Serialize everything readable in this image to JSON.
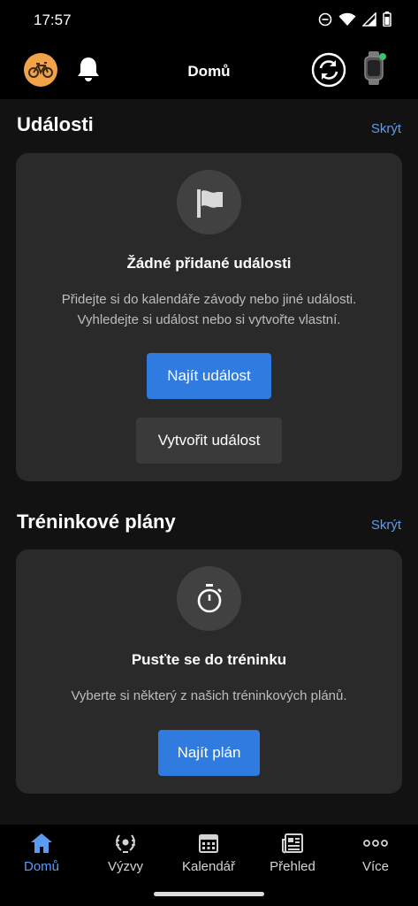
{
  "status": {
    "time": "17:57"
  },
  "header": {
    "title": "Domů"
  },
  "events": {
    "title": "Události",
    "hide": "Skrýt",
    "heading": "Žádné přidané události",
    "text_line1": "Přidejte si do kalendáře závody nebo jiné události.",
    "text_line2": "Vyhledejte si událost nebo si vytvořte vlastní.",
    "find_button": "Najít událost",
    "create_button": "Vytvořit událost"
  },
  "plans": {
    "title": "Tréninkové plány",
    "hide": "Skrýt",
    "heading": "Pusťte se do tréninku",
    "text": "Vyberte si některý z našich tréninkových plánů.",
    "find_button": "Najít plán"
  },
  "nav": {
    "items": [
      {
        "label": "Domů",
        "icon": "home-icon",
        "active": true
      },
      {
        "label": "Výzvy",
        "icon": "laurel-icon"
      },
      {
        "label": "Kalendář",
        "icon": "calendar-icon"
      },
      {
        "label": "Přehled",
        "icon": "news-icon"
      },
      {
        "label": "Více",
        "icon": "more-icon"
      }
    ]
  },
  "colors": {
    "accent": "#2f7be0",
    "link": "#5b9cf2",
    "avatar": "#f2a34a",
    "online": "#3ec46d"
  }
}
